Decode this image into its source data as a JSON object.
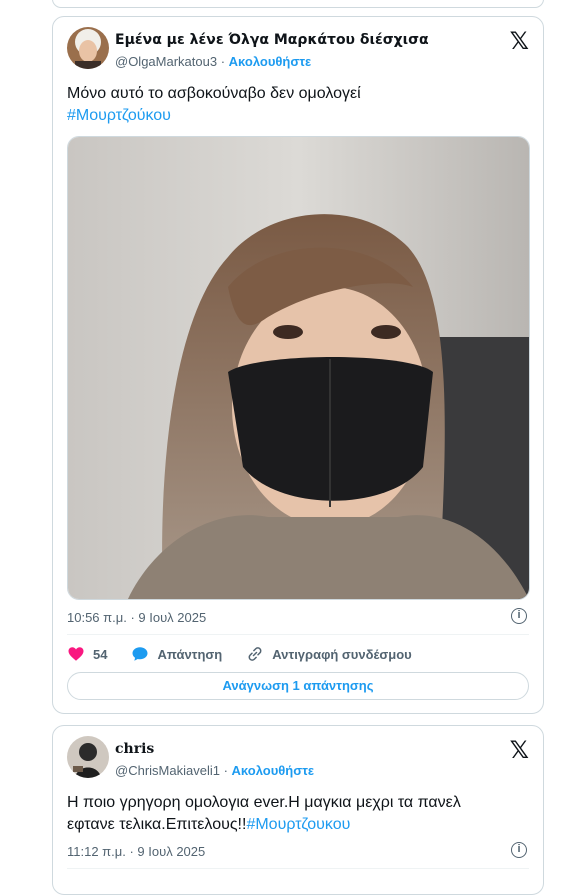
{
  "tweet1": {
    "display_name": "Εμένα με λένε Όλγα Μαρκάτου διέσχισα",
    "handle": "@OlgaMarkatou3",
    "separator": "·",
    "follow_label": "Ακολουθήστε",
    "text": "Μόνο αυτό το ασβοκούναβο δεν ομολογεί",
    "hashtag": "#Μουρτζούκου",
    "timestamp": "10:56 π.μ. · 9 Ιουλ 2025",
    "likes": "54",
    "reply_label": "Απάντηση",
    "copy_link_label": "Αντιγραφή συνδέσμου",
    "read_replies_label": "Ανάγνωση 1 απάντησης"
  },
  "tweet2": {
    "display_name": "chris",
    "handle": "@ChrisMakiaveli1",
    "separator": "·",
    "follow_label": "Ακολουθήστε",
    "text_line1": "Η ποιο γρηγορη ομολογια ever.Η μαγκια μεχρι τα πανελ",
    "text_line2": "εφτανε τελικα.Επιτελους!!",
    "hashtag": "#Μουρτζουκου",
    "timestamp": "11:12 π.μ. · 9 Ιουλ 2025"
  },
  "icons": {
    "x_logo": "x-logo-icon",
    "like": "heart-icon",
    "reply": "speech-bubble-icon",
    "link": "link-icon",
    "info": "info-icon"
  },
  "colors": {
    "accent": "#1d9bf0",
    "like": "#f91880",
    "secondary_text": "#536471",
    "border": "#cfd9de"
  }
}
